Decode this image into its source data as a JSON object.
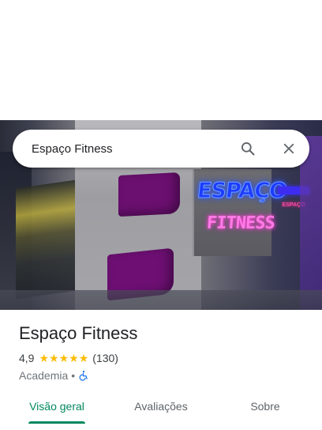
{
  "search": {
    "query": "Espaço Fitness",
    "search_icon": "search-icon",
    "close_icon": "close-icon"
  },
  "hero": {
    "neon_line1": "ESPAÇO",
    "neon_line2": "FITNESS",
    "neon_side": "ESPAÇO"
  },
  "place": {
    "name": "Espaço Fitness",
    "rating": "4,9",
    "stars": 5,
    "reviews": "(130)",
    "category": "Academia",
    "separator": "•",
    "accessibility_icon": "wheelchair-icon"
  },
  "tabs": [
    {
      "label": "Visão geral",
      "active": true
    },
    {
      "label": "Avaliações",
      "active": false
    },
    {
      "label": "Sobre",
      "active": false
    }
  ],
  "colors": {
    "accent": "#01875f",
    "star": "#fbbc04",
    "accessibility": "#1a73e8"
  }
}
